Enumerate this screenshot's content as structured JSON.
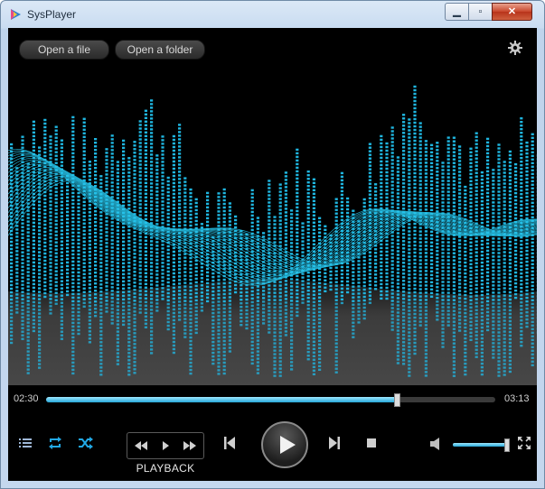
{
  "window": {
    "title": "SysPlayer",
    "accent": "#1fb6e0"
  },
  "toolbar": {
    "open_file": "Open a file",
    "open_folder": "Open a folder",
    "settings_icon": "gear-icon"
  },
  "player": {
    "current_time": "02:30",
    "total_time": "03:13",
    "progress": 0.78,
    "volume": 0.95,
    "playback_label": "PLAYBACK"
  },
  "icons": [
    "playlist-icon",
    "repeat-icon",
    "shuffle-icon",
    "rewind-icon",
    "play-small-icon",
    "fast-forward-icon",
    "previous-track-icon",
    "play-icon",
    "next-track-icon",
    "stop-icon",
    "volume-icon",
    "fullscreen-icon"
  ]
}
